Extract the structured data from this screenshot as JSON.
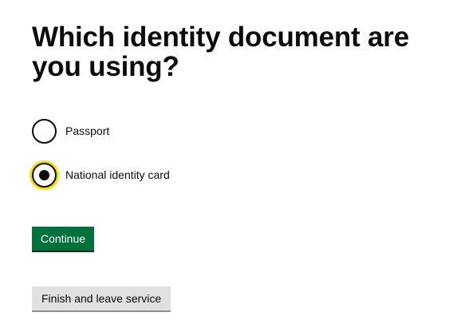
{
  "question": {
    "heading": "Which identity document are you using?"
  },
  "radios": {
    "options": [
      {
        "label": "Passport",
        "selected": false
      },
      {
        "label": "National identity card",
        "selected": true
      }
    ]
  },
  "buttons": {
    "continue_label": "Continue",
    "leave_label": "Finish and leave service"
  },
  "colors": {
    "primary_button": "#00703c",
    "secondary_button": "#e0e1e1",
    "focus": "#ffdd00",
    "text": "#0b0c0c"
  }
}
